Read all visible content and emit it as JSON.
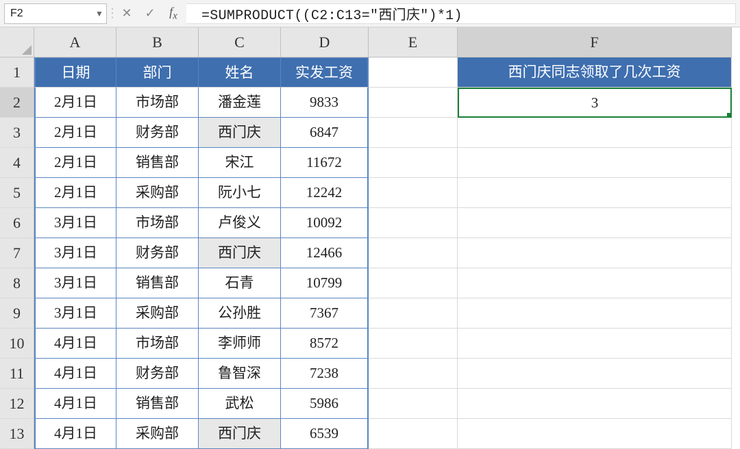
{
  "nameBox": "F2",
  "formula": "=SUMPRODUCT((C2:C13=\"西门庆\")*1)",
  "columns": [
    "A",
    "B",
    "C",
    "D",
    "E",
    "F"
  ],
  "rowNumbers": [
    1,
    2,
    3,
    4,
    5,
    6,
    7,
    8,
    9,
    10,
    11,
    12,
    13
  ],
  "headers": {
    "A": "日期",
    "B": "部门",
    "C": "姓名",
    "D": "实发工资"
  },
  "rows": [
    {
      "A": "2月1日",
      "B": "市场部",
      "C": "潘金莲",
      "D": "9833"
    },
    {
      "A": "2月1日",
      "B": "财务部",
      "C": "西门庆",
      "D": "6847"
    },
    {
      "A": "2月1日",
      "B": "销售部",
      "C": "宋江",
      "D": "11672"
    },
    {
      "A": "2月1日",
      "B": "采购部",
      "C": "阮小七",
      "D": "12242"
    },
    {
      "A": "3月1日",
      "B": "市场部",
      "C": "卢俊义",
      "D": "10092"
    },
    {
      "A": "3月1日",
      "B": "财务部",
      "C": "西门庆",
      "D": "12466"
    },
    {
      "A": "3月1日",
      "B": "销售部",
      "C": "石青",
      "D": "10799"
    },
    {
      "A": "3月1日",
      "B": "采购部",
      "C": "公孙胜",
      "D": "7367"
    },
    {
      "A": "4月1日",
      "B": "市场部",
      "C": "李师师",
      "D": "8572"
    },
    {
      "A": "4月1日",
      "B": "财务部",
      "C": "鲁智深",
      "D": "7238"
    },
    {
      "A": "4月1日",
      "B": "销售部",
      "C": "武松",
      "D": "5986"
    },
    {
      "A": "4月1日",
      "B": "采购部",
      "C": "西门庆",
      "D": "6539"
    }
  ],
  "side": {
    "F1": "西门庆同志领取了几次工资",
    "F2": "3"
  },
  "highlightName": "西门庆",
  "activeCell": "F2"
}
